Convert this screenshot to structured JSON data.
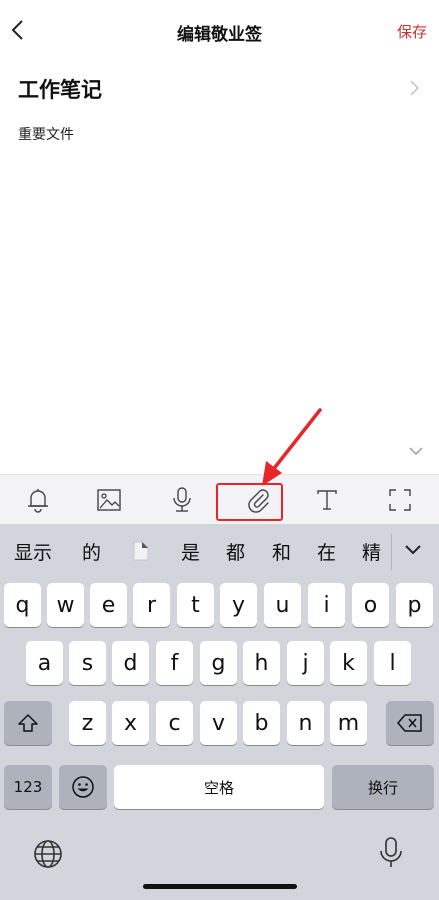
{
  "header": {
    "title": "编辑敬业签",
    "save_label": "保存"
  },
  "note": {
    "category": "工作笔记",
    "content": "重要文件"
  },
  "toolbar": {
    "items": [
      "bell-icon",
      "image-icon",
      "mic-icon",
      "paperclip-icon",
      "text-format-icon",
      "fullscreen-icon"
    ],
    "highlighted": "paperclip-icon",
    "highlight_color": "#e8262a"
  },
  "keyboard": {
    "candidates": [
      "显示",
      "的",
      "是",
      "都",
      "和",
      "在",
      "精"
    ],
    "row1": [
      "q",
      "w",
      "e",
      "r",
      "t",
      "y",
      "u",
      "i",
      "o",
      "p"
    ],
    "row2": [
      "a",
      "s",
      "d",
      "f",
      "g",
      "h",
      "j",
      "k",
      "l"
    ],
    "row3": [
      "z",
      "x",
      "c",
      "v",
      "b",
      "n",
      "m"
    ],
    "num_label": "123",
    "space_label": "空格",
    "return_label": "换行"
  },
  "colors": {
    "accent": "#d0312d",
    "keyboard_bg": "#d2d5db"
  }
}
